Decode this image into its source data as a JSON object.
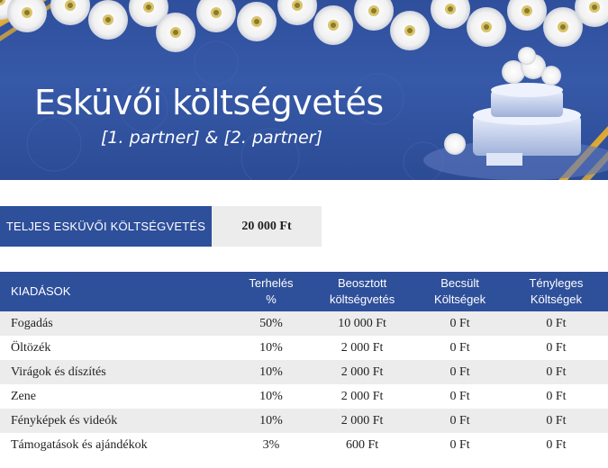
{
  "header": {
    "title": "Esküvői költségvetés",
    "subtitle": "[1. partner] & [2. partner]"
  },
  "total": {
    "label": "TELJES ESKÜVŐI KÖLTSÉGVETÉS",
    "value": "20 000 Ft"
  },
  "table": {
    "headers": [
      [
        "KIADÁSOK"
      ],
      [
        "Terhelés",
        "%"
      ],
      [
        "Beosztott",
        "költségvetés"
      ],
      [
        "Becsült",
        "Költségek"
      ],
      [
        "Tényleges",
        "Költségek"
      ]
    ],
    "rows": [
      [
        "Fogadás",
        "50%",
        "10 000 Ft",
        "0 Ft",
        "0 Ft"
      ],
      [
        "Öltözék",
        "10%",
        "2 000 Ft",
        "0 Ft",
        "0 Ft"
      ],
      [
        "Virágok és díszítés",
        "10%",
        "2 000 Ft",
        "0 Ft",
        "0 Ft"
      ],
      [
        "Zene",
        "10%",
        "2 000 Ft",
        "0 Ft",
        "0 Ft"
      ],
      [
        "Fényképek és videók",
        "10%",
        "2 000 Ft",
        "0 Ft",
        "0 Ft"
      ],
      [
        "Támogatások és ajándékok",
        "3%",
        "600 Ft",
        "0 Ft",
        "0 Ft"
      ]
    ]
  },
  "colors": {
    "header_blue": "#2e4f9a",
    "row_stripe": "#ececec",
    "ribbon_gold": "#e9b949"
  }
}
